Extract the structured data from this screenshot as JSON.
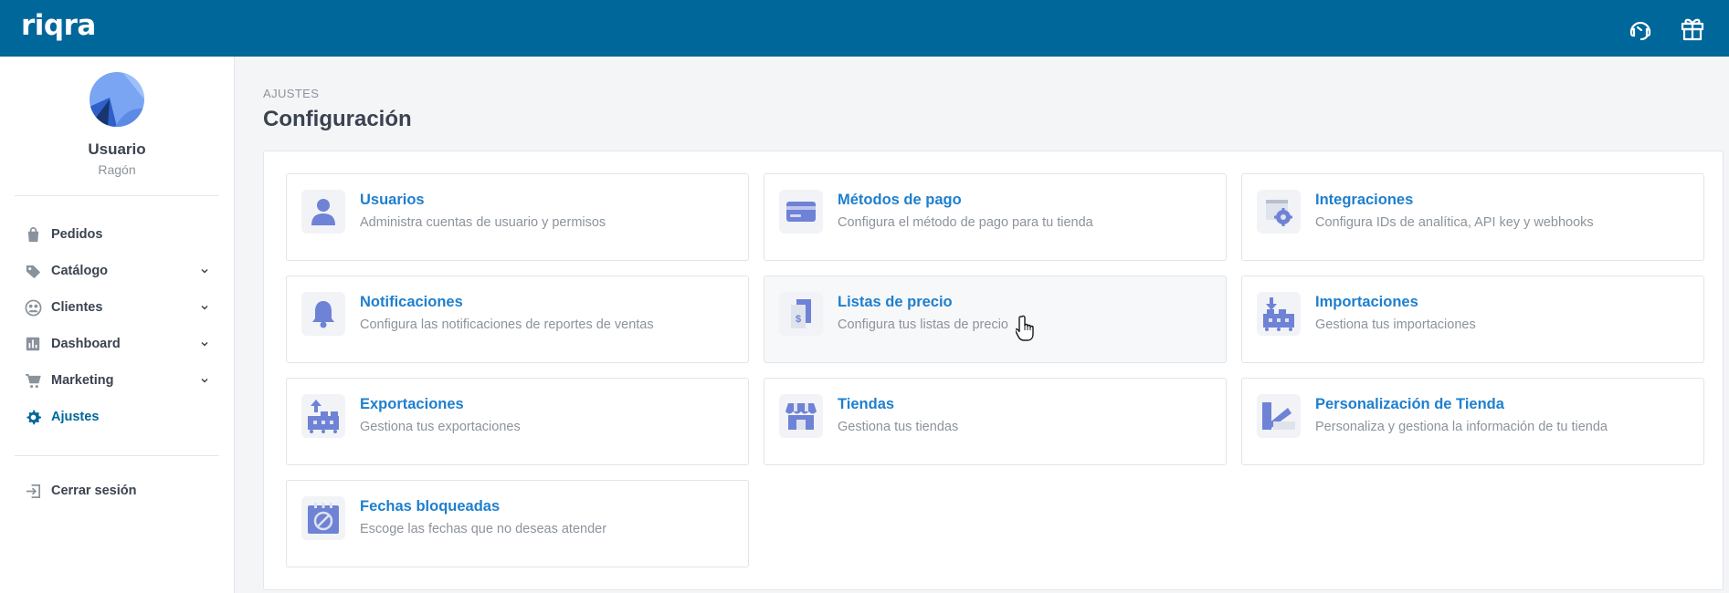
{
  "app": {
    "logo": "riqra"
  },
  "colors": {
    "brand": "#00679a",
    "accent": "#1e7fce",
    "icon": "#6e82d6"
  },
  "topbar": {
    "icons": [
      "headset-icon",
      "gift-icon"
    ]
  },
  "sidebar": {
    "user_name": "Usuario",
    "company": "Ragón",
    "items": [
      {
        "label": "Pedidos",
        "icon": "bag-icon",
        "expandable": false
      },
      {
        "label": "Catálogo",
        "icon": "tag-icon",
        "expandable": true
      },
      {
        "label": "Clientes",
        "icon": "users-icon",
        "expandable": true
      },
      {
        "label": "Dashboard",
        "icon": "chart-icon",
        "expandable": true
      },
      {
        "label": "Marketing",
        "icon": "cart-icon",
        "expandable": true
      },
      {
        "label": "Ajustes",
        "icon": "gear-icon",
        "expandable": false,
        "active": true
      }
    ],
    "logout": {
      "label": "Cerrar sesión",
      "icon": "logout-icon"
    }
  },
  "main": {
    "breadcrumb": "AJUSTES",
    "title": "Configuración",
    "cards": [
      {
        "title": "Usuarios",
        "desc": "Administra cuentas de usuario y permisos",
        "icon": "user-icon"
      },
      {
        "title": "Métodos de pago",
        "desc": "Configura el método de pago para tu tienda",
        "icon": "credit-card-icon"
      },
      {
        "title": "Integraciones",
        "desc": "Configura IDs de analítica, API key y webhooks",
        "icon": "integration-gear-icon"
      },
      {
        "title": "Notificaciones",
        "desc": "Configura las notificaciones de reportes de ventas",
        "icon": "bell-icon"
      },
      {
        "title": "Listas de precio",
        "desc": "Configura tus listas de precio",
        "icon": "price-list-icon"
      },
      {
        "title": "Importaciones",
        "desc": "Gestiona tus importaciones",
        "icon": "import-icon"
      },
      {
        "title": "Exportaciones",
        "desc": "Gestiona tus exportaciones",
        "icon": "export-icon"
      },
      {
        "title": "Tiendas",
        "desc": "Gestiona tus tiendas",
        "icon": "store-icon"
      },
      {
        "title": "Personalización de Tienda",
        "desc": "Personaliza y gestiona la información de tu tienda",
        "icon": "customize-icon"
      },
      {
        "title": "Fechas bloqueadas",
        "desc": "Escoge las fechas que no deseas atender",
        "icon": "blocked-calendar-icon"
      }
    ]
  }
}
